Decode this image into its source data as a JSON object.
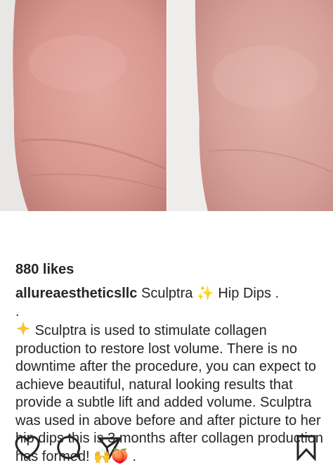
{
  "post": {
    "likes": "880 likes",
    "username": "allureaestheticsllc",
    "caption_line1": " Sculptra ✨ Hip Dips .",
    "caption_dot": ".",
    "caption_body": "Sculptra is used to stimulate collagen production to restore lost volume. There is no downtime after the procedure, you can expect to achieve beautiful, natural looking results that provide a subtle lift and added volume. Sculptra was used in above before and after picture to her hip dips this is 3 months after collagen production has formed!",
    "caption_end_emoji": "🙌🍑 ."
  },
  "images": {
    "before": "before-photo",
    "after": "after-photo"
  },
  "icons": [
    "heart-icon",
    "comment-icon",
    "share-icon",
    "bookmark-icon",
    "star-icon"
  ],
  "colors": {
    "text": "#262626",
    "skin": "#d8a39c"
  }
}
